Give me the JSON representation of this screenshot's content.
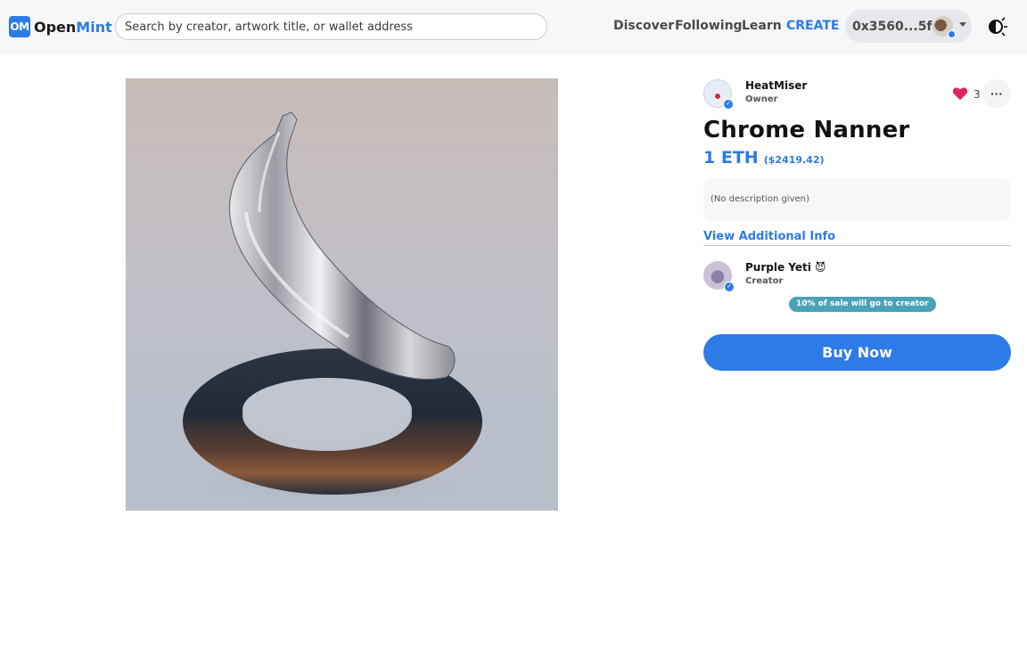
{
  "header": {
    "logo_badge": "OM",
    "logo_text_main": "Open",
    "logo_text_accent": "Mint",
    "search_placeholder": "Search by creator, artwork title, or wallet address",
    "nav": {
      "discover": "Discover",
      "following": "Following",
      "learn": "Learn",
      "create": "CREATE"
    },
    "wallet_address": "0x3560...5fc",
    "icons": {
      "wallet_avatar": "user-avatar-icon",
      "dropdown": "chevron-down-icon",
      "theme": "theme-toggle-icon"
    }
  },
  "artwork": {
    "image_description_icon": "artwork-image"
  },
  "owner": {
    "name": "HeatMiser",
    "role": "Owner"
  },
  "likes": {
    "count": "3",
    "icon": "heart-icon"
  },
  "more_label": "···",
  "item": {
    "title": "Chrome Nanner",
    "price_eth": "1 ETH",
    "price_usd": "($2419.42)",
    "description": "(No description given)",
    "additional_info_label": "View Additional Info"
  },
  "creator": {
    "name": "Purple Yeti 😈",
    "role": "Creator",
    "royalty_badge": "10% of sale will go to creator"
  },
  "buy_button_label": "Buy Now",
  "colors": {
    "accent": "#2d7be6",
    "royalty_badge": "#4aa3b8",
    "heart": "#e0245e"
  }
}
